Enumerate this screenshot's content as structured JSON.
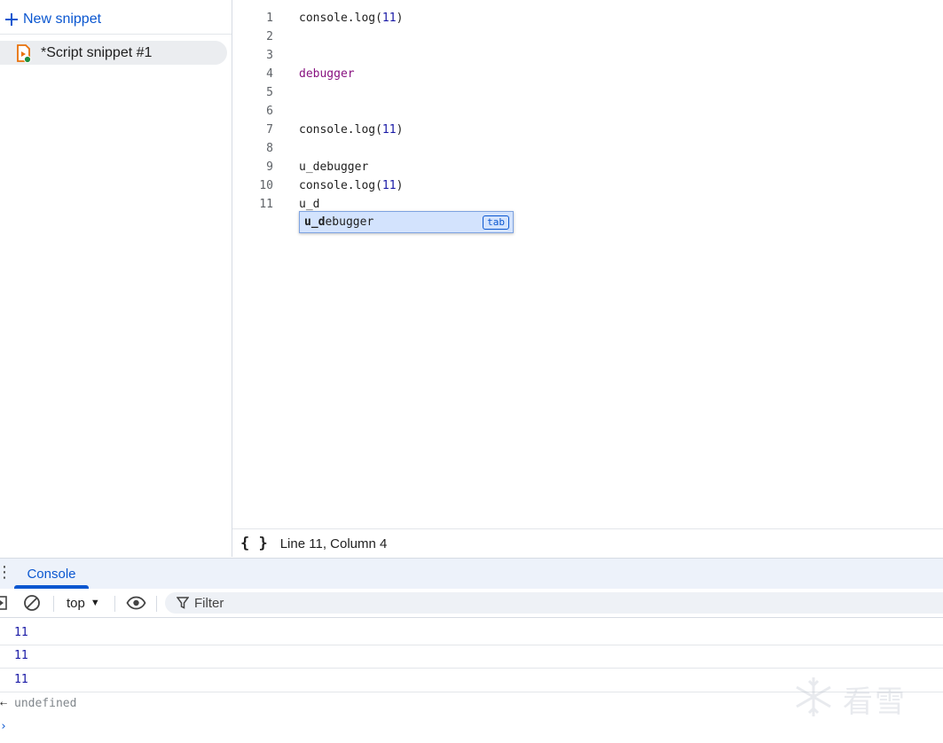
{
  "sidebar": {
    "new_snippet_label": "New snippet",
    "snippets": [
      {
        "label": "*Script snippet #1"
      }
    ]
  },
  "editor": {
    "lines": [
      {
        "num": "1",
        "code": "console.log(11)"
      },
      {
        "num": "2",
        "code": ""
      },
      {
        "num": "3",
        "code": ""
      },
      {
        "num": "4",
        "code": "debugger"
      },
      {
        "num": "5",
        "code": ""
      },
      {
        "num": "6",
        "code": ""
      },
      {
        "num": "7",
        "code": "console.log(11)"
      },
      {
        "num": "8",
        "code": ""
      },
      {
        "num": "9",
        "code": "u_debugger"
      },
      {
        "num": "10",
        "code": "console.log(11)"
      },
      {
        "num": "11",
        "code": "u_d"
      }
    ],
    "autocomplete": {
      "match": "u_d",
      "rest": "ebugger",
      "hint": "tab"
    }
  },
  "statusbar": {
    "braces": "{ }",
    "position": "Line 11, Column 4"
  },
  "drawer": {
    "console_tab": "Console"
  },
  "console": {
    "context": "top",
    "filter_placeholder": "Filter",
    "outputs": [
      "11",
      "11",
      "11"
    ],
    "return_value": "undefined"
  },
  "watermark": {
    "text": "看雪"
  },
  "colors": {
    "accent": "#0b57d0",
    "keyword": "#881280",
    "number": "#1a1aa6"
  }
}
